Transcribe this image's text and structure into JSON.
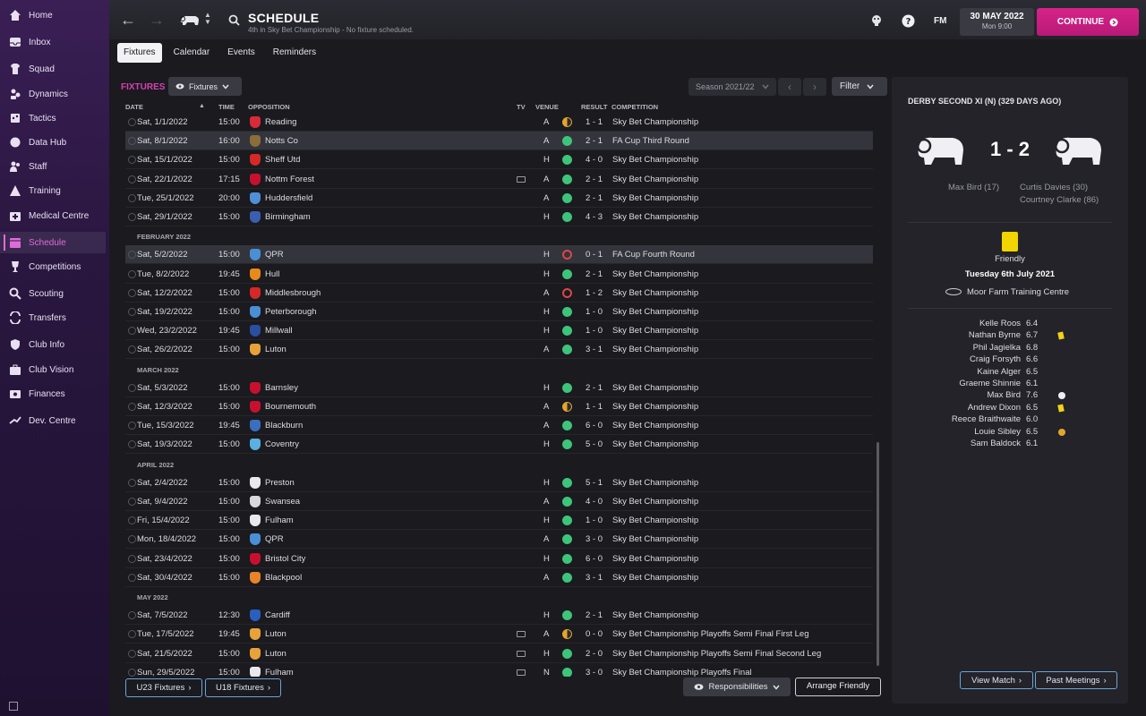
{
  "sidebar": {
    "items": [
      {
        "label": "Home",
        "icon": "home-icon"
      },
      {
        "label": "Inbox",
        "icon": "inbox-icon"
      },
      {
        "label": "Squad",
        "icon": "squad-icon"
      },
      {
        "label": "Dynamics",
        "icon": "dynamics-icon"
      },
      {
        "label": "Tactics",
        "icon": "tactics-icon"
      },
      {
        "label": "Data Hub",
        "icon": "data-hub-icon"
      },
      {
        "label": "Staff",
        "icon": "staff-icon"
      },
      {
        "label": "Training",
        "icon": "training-icon"
      },
      {
        "label": "Medical Centre",
        "icon": "medical-icon"
      },
      {
        "label": "Schedule",
        "icon": "calendar-icon",
        "active": true
      },
      {
        "label": "Competitions",
        "icon": "trophy-icon"
      },
      {
        "label": "Scouting",
        "icon": "scouting-icon"
      },
      {
        "label": "Transfers",
        "icon": "transfers-icon"
      },
      {
        "label": "Club Info",
        "icon": "shield-icon"
      },
      {
        "label": "Club Vision",
        "icon": "briefcase-icon"
      },
      {
        "label": "Finances",
        "icon": "finances-icon"
      },
      {
        "label": "Dev. Centre",
        "icon": "dev-centre-icon"
      }
    ]
  },
  "header": {
    "title": "SCHEDULE",
    "subtitle": "4th in Sky Bet Championship - No fixture scheduled.",
    "fm_label": "FM",
    "date": "30 MAY 2022",
    "time": "Mon 9:00",
    "continue_label": "CONTINUE"
  },
  "tabs": [
    "Fixtures",
    "Calendar",
    "Events",
    "Reminders"
  ],
  "main": {
    "section_label": "FIXTURES",
    "view_dropdown": "Fixtures",
    "season": "Season 2021/22",
    "filter_label": "Filter",
    "columns": {
      "date": "DATE",
      "time": "TIME",
      "opposition": "OPPOSITION",
      "tv": "TV",
      "venue": "VENUE",
      "result": "RESULT",
      "competition": "COMPETITION"
    },
    "u23_label": "U23 Fixtures",
    "u18_label": "U18 Fixtures",
    "responsibilities_label": "Responsibilities",
    "arrange_label": "Arrange Friendly"
  },
  "rows": [
    {
      "date": "Sat, 1/1/2022",
      "time": "15:00",
      "opp": "Reading",
      "venue": "A",
      "outcome": "draw",
      "result": "1 - 1",
      "comp": "Sky Bet Championship",
      "crest": "#d92a3a"
    },
    {
      "date": "Sat, 8/1/2022",
      "time": "16:00",
      "opp": "Notts Co",
      "venue": "A",
      "outcome": "win",
      "result": "2 - 1",
      "comp": "FA Cup Third Round",
      "crest": "#8a6d3b",
      "highlight": true
    },
    {
      "date": "Sat, 15/1/2022",
      "time": "15:00",
      "opp": "Sheff Utd",
      "venue": "H",
      "outcome": "win",
      "result": "4 - 0",
      "comp": "Sky Bet Championship",
      "crest": "#d62828"
    },
    {
      "date": "Sat, 22/1/2022",
      "time": "17:15",
      "opp": "Nottm Forest",
      "tv": true,
      "venue": "A",
      "outcome": "win",
      "result": "2 - 1",
      "comp": "Sky Bet Championship",
      "crest": "#c8102e"
    },
    {
      "date": "Tue, 25/1/2022",
      "time": "20:00",
      "opp": "Huddersfield",
      "venue": "A",
      "outcome": "win",
      "result": "2 - 1",
      "comp": "Sky Bet Championship",
      "crest": "#4f8fd6"
    },
    {
      "date": "Sat, 29/1/2022",
      "time": "15:00",
      "opp": "Birmingham",
      "venue": "H",
      "outcome": "win",
      "result": "4 - 3",
      "comp": "Sky Bet Championship",
      "crest": "#3a5fb0"
    },
    {
      "month": "FEBRUARY 2022"
    },
    {
      "date": "Sat, 5/2/2022",
      "time": "15:00",
      "opp": "QPR",
      "venue": "H",
      "outcome": "loss",
      "result": "0 - 1",
      "comp": "FA Cup Fourth Round",
      "crest": "#4a8fd6",
      "highlight": true
    },
    {
      "date": "Tue, 8/2/2022",
      "time": "19:45",
      "opp": "Hull",
      "venue": "H",
      "outcome": "win",
      "result": "2 - 1",
      "comp": "Sky Bet Championship",
      "crest": "#e88a1a"
    },
    {
      "date": "Sat, 12/2/2022",
      "time": "15:00",
      "opp": "Middlesbrough",
      "venue": "A",
      "outcome": "loss",
      "result": "1 - 2",
      "comp": "Sky Bet Championship",
      "crest": "#d62828"
    },
    {
      "date": "Sat, 19/2/2022",
      "time": "15:00",
      "opp": "Peterborough",
      "venue": "H",
      "outcome": "win",
      "result": "1 - 0",
      "comp": "Sky Bet Championship",
      "crest": "#4a8fd6"
    },
    {
      "date": "Wed, 23/2/2022",
      "time": "19:45",
      "opp": "Millwall",
      "venue": "H",
      "outcome": "win",
      "result": "1 - 0",
      "comp": "Sky Bet Championship",
      "crest": "#2a4fa0"
    },
    {
      "date": "Sat, 26/2/2022",
      "time": "15:00",
      "opp": "Luton",
      "venue": "A",
      "outcome": "win",
      "result": "3 - 1",
      "comp": "Sky Bet Championship",
      "crest": "#e8a23a"
    },
    {
      "month": "MARCH 2022"
    },
    {
      "date": "Sat, 5/3/2022",
      "time": "15:00",
      "opp": "Barnsley",
      "venue": "H",
      "outcome": "win",
      "result": "2 - 1",
      "comp": "Sky Bet Championship",
      "crest": "#c8102e"
    },
    {
      "date": "Sat, 12/3/2022",
      "time": "15:00",
      "opp": "Bournemouth",
      "venue": "A",
      "outcome": "draw",
      "result": "1 - 1",
      "comp": "Sky Bet Championship",
      "crest": "#c8102e"
    },
    {
      "date": "Tue, 15/3/2022",
      "time": "19:45",
      "opp": "Blackburn",
      "venue": "A",
      "outcome": "win",
      "result": "6 - 0",
      "comp": "Sky Bet Championship",
      "crest": "#3a6fc0"
    },
    {
      "date": "Sat, 19/3/2022",
      "time": "15:00",
      "opp": "Coventry",
      "venue": "H",
      "outcome": "win",
      "result": "5 - 0",
      "comp": "Sky Bet Championship",
      "crest": "#5ab0e0"
    },
    {
      "month": "APRIL 2022"
    },
    {
      "date": "Sat, 2/4/2022",
      "time": "15:00",
      "opp": "Preston",
      "venue": "H",
      "outcome": "win",
      "result": "5 - 1",
      "comp": "Sky Bet Championship",
      "crest": "#e8e8ee"
    },
    {
      "date": "Sat, 9/4/2022",
      "time": "15:00",
      "opp": "Swansea",
      "venue": "A",
      "outcome": "win",
      "result": "4 - 0",
      "comp": "Sky Bet Championship",
      "crest": "#d8d8de"
    },
    {
      "date": "Fri, 15/4/2022",
      "time": "15:00",
      "opp": "Fulham",
      "venue": "H",
      "outcome": "win",
      "result": "1 - 0",
      "comp": "Sky Bet Championship",
      "crest": "#e8e8ee"
    },
    {
      "date": "Mon, 18/4/2022",
      "time": "15:00",
      "opp": "QPR",
      "venue": "A",
      "outcome": "win",
      "result": "3 - 0",
      "comp": "Sky Bet Championship",
      "crest": "#4a8fd6"
    },
    {
      "date": "Sat, 23/4/2022",
      "time": "15:00",
      "opp": "Bristol City",
      "venue": "H",
      "outcome": "win",
      "result": "6 - 0",
      "comp": "Sky Bet Championship",
      "crest": "#c8102e"
    },
    {
      "date": "Sat, 30/4/2022",
      "time": "15:00",
      "opp": "Blackpool",
      "venue": "A",
      "outcome": "win",
      "result": "3 - 1",
      "comp": "Sky Bet Championship",
      "crest": "#e8832a"
    },
    {
      "month": "MAY 2022"
    },
    {
      "date": "Sat, 7/5/2022",
      "time": "12:30",
      "opp": "Cardiff",
      "venue": "H",
      "outcome": "win",
      "result": "2 - 1",
      "comp": "Sky Bet Championship",
      "crest": "#2a5fc0"
    },
    {
      "date": "Tue, 17/5/2022",
      "time": "19:45",
      "opp": "Luton",
      "tv": true,
      "venue": "A",
      "outcome": "draw",
      "result": "0 - 0",
      "comp": "Sky Bet Championship Playoffs Semi Final First Leg",
      "crest": "#e8a23a"
    },
    {
      "date": "Sat, 21/5/2022",
      "time": "15:00",
      "opp": "Luton",
      "tv": true,
      "venue": "H",
      "outcome": "win",
      "result": "2 - 0",
      "comp": "Sky Bet Championship Playoffs Semi Final Second Leg",
      "crest": "#e8a23a"
    },
    {
      "date": "Sun, 29/5/2022",
      "time": "15:00",
      "opp": "Fulham",
      "tv": true,
      "venue": "N",
      "outcome": "win",
      "result": "3 - 0",
      "comp": "Sky Bet Championship Playoffs Final",
      "crest": "#e8e8ee"
    }
  ],
  "colors": {
    "win": "#3ec47a",
    "draw": "#e5a52a",
    "loss": "#d94848",
    "accent": "#d93fb4"
  },
  "match_panel": {
    "title": "DERBY SECOND XI (N) (329 DAYS AGO)",
    "score": "1 - 2",
    "home_scorers": [
      "Max Bird (17)"
    ],
    "away_scorers": [
      "Curtis Davies (30)",
      "Courtney Clarke (86)"
    ],
    "competition": "Friendly",
    "date": "Tuesday 6th July 2021",
    "venue": "Moor Farm Training Centre",
    "players": [
      {
        "name": "Kelle Roos",
        "rating": "6.4",
        "mark": ""
      },
      {
        "name": "Nathan Byrne",
        "rating": "6.7",
        "mark": "yellow-card"
      },
      {
        "name": "Phil Jagielka",
        "rating": "6.8",
        "mark": ""
      },
      {
        "name": "Craig Forsyth",
        "rating": "6.6",
        "mark": ""
      },
      {
        "name": "Kaine Alger",
        "rating": "6.5",
        "mark": ""
      },
      {
        "name": "Graeme Shinnie",
        "rating": "6.1",
        "mark": ""
      },
      {
        "name": "Max Bird",
        "rating": "7.6",
        "mark": "goal"
      },
      {
        "name": "Andrew Dixon",
        "rating": "6.5",
        "mark": "yellow-card"
      },
      {
        "name": "Reece Braithwaite",
        "rating": "6.0",
        "mark": ""
      },
      {
        "name": "Louie Sibley",
        "rating": "6.5",
        "mark": "substitution"
      },
      {
        "name": "Sam Baldock",
        "rating": "6.1",
        "mark": ""
      }
    ],
    "view_match_label": "View Match",
    "past_meetings_label": "Past Meetings"
  }
}
